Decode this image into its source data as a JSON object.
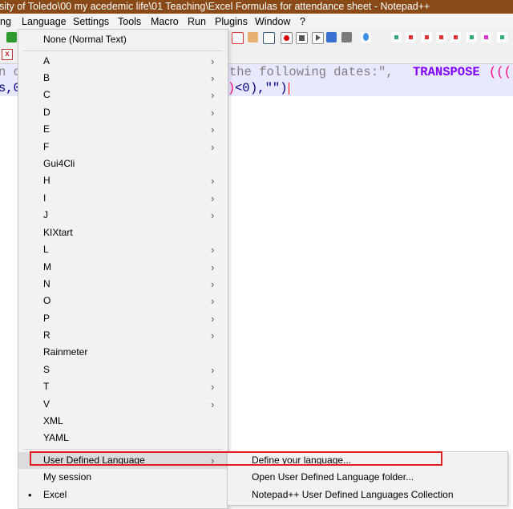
{
  "window": {
    "title": "sity of Toledo\\00 my acedemic life\\01 Teaching\\Excel Formulas for attendance sheet - Notepad++"
  },
  "menubar": {
    "items": [
      "ng",
      "Language",
      "Settings",
      "Tools",
      "Macro",
      "Run",
      "Plugins",
      "Window",
      "?"
    ]
  },
  "editor": {
    "line1": {
      "a": "n o",
      "b": " the following dates:\",",
      "c": "TRANSPOSE",
      "d": "((("
    },
    "line2": {
      "a": "s,0",
      "b": ")",
      "c": "<0",
      "d": "),\"\")"
    }
  },
  "tab": {
    "close_glyph": "x"
  },
  "language_menu": {
    "items": [
      {
        "label": "None (Normal Text)",
        "submenu": false
      },
      {
        "label": "A",
        "submenu": true
      },
      {
        "label": "B",
        "submenu": true
      },
      {
        "label": "C",
        "submenu": true
      },
      {
        "label": "D",
        "submenu": true
      },
      {
        "label": "E",
        "submenu": true
      },
      {
        "label": "F",
        "submenu": true
      },
      {
        "label": "Gui4Cli",
        "submenu": false
      },
      {
        "label": "H",
        "submenu": true
      },
      {
        "label": "I",
        "submenu": true
      },
      {
        "label": "J",
        "submenu": true
      },
      {
        "label": "KIXtart",
        "submenu": false
      },
      {
        "label": "L",
        "submenu": true
      },
      {
        "label": "M",
        "submenu": true
      },
      {
        "label": "N",
        "submenu": true
      },
      {
        "label": "O",
        "submenu": true
      },
      {
        "label": "P",
        "submenu": true
      },
      {
        "label": "R",
        "submenu": true
      },
      {
        "label": "Rainmeter",
        "submenu": false
      },
      {
        "label": "S",
        "submenu": true
      },
      {
        "label": "T",
        "submenu": true
      },
      {
        "label": "V",
        "submenu": true
      },
      {
        "label": "XML",
        "submenu": false
      },
      {
        "label": "YAML",
        "submenu": false
      },
      {
        "label": "User Defined Language",
        "submenu": true
      },
      {
        "label": "My session",
        "submenu": false
      },
      {
        "label": "Excel",
        "submenu": false,
        "selected": true
      }
    ],
    "arrow_glyph": "›",
    "bullet_glyph": "•"
  },
  "udl_submenu": {
    "items": [
      "Define your language...",
      "Open User Defined Language folder...",
      "Notepad++ User Defined Languages Collection"
    ]
  },
  "colors": {
    "title_bar": "#8a4a18",
    "highlight_box": "#e02020",
    "current_line": "#e8e8ff"
  },
  "toolbar": {
    "icons": [
      "redo-icon",
      "find-function-icon",
      "open-folder-icon",
      "eye-icon",
      "record-macro-icon",
      "stop-macro-icon",
      "play-macro-icon",
      "run-macro-multiple-icon",
      "save-macro-icon",
      "drop-icon",
      "bookmark-icon",
      "prev-bookmark-icon",
      "next-bookmark-icon"
    ]
  }
}
